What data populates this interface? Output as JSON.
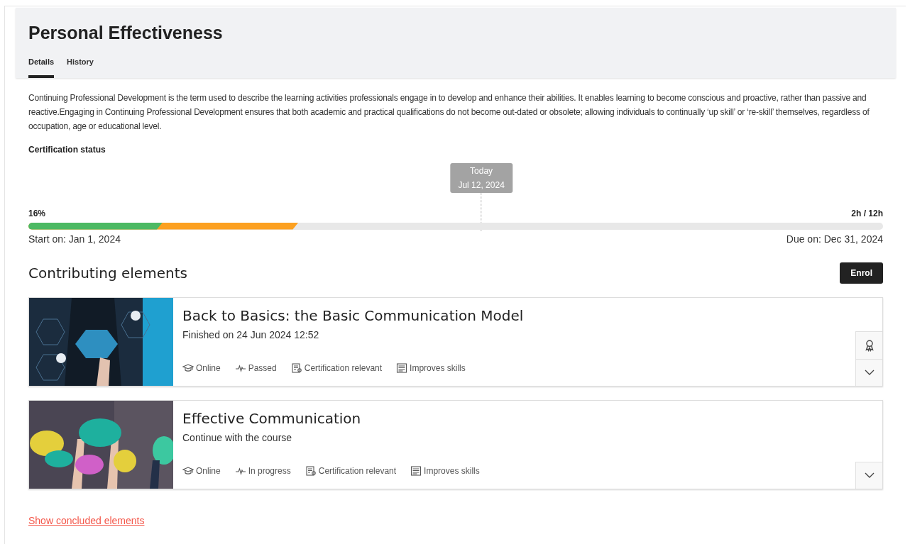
{
  "header": {
    "title": "Personal Effectiveness",
    "tabs": [
      {
        "label": "Details",
        "selected": true
      },
      {
        "label": "History",
        "selected": false
      }
    ]
  },
  "description": "Continuing Professional Development is the term used to describe the learning activities professionals engage in to develop and enhance their abilities. It enables learning to become conscious and proactive, rather than passive and reactive.Engaging in Continuing Professional Development ensures that both academic and practical qualifications do not become out-dated or obsolete; allowing individuals to continually ‘up skill’ or ‘re-skill’ themselves, regardless of occupation, age or educational level.",
  "certification": {
    "heading": "Certification status",
    "percent": "16%",
    "hours": "2h / 12h",
    "completed": {
      "level": 0.157
    },
    "in_progress": {
      "level": 0.316
    },
    "today": {
      "label": "Today",
      "date": "Jul 12, 2024",
      "level": 0.53
    },
    "start": "Start on: Jan 1, 2024",
    "due": "Due on: Dec 31, 2024"
  },
  "contributing": {
    "heading": "Contributing elements",
    "button": "Enrol",
    "items": [
      {
        "title": "Back to Basics: the Basic Communication Model",
        "subtitle": "Finished on 24 Jun 2024 12:52",
        "certificate": true,
        "expanded": false,
        "tags": [
          {
            "kind": "mode",
            "label": "Online"
          },
          {
            "kind": "status",
            "label": "Passed"
          },
          {
            "kind": "certification",
            "label": "Certification relevant"
          },
          {
            "kind": "skills",
            "label": "Improves skills"
          }
        ]
      },
      {
        "title": "Effective Communication",
        "subtitle": "Continue with the course",
        "certificate": false,
        "expanded": false,
        "tags": [
          {
            "kind": "mode",
            "label": "Online"
          },
          {
            "kind": "status",
            "label": "In progress"
          },
          {
            "kind": "certification",
            "label": "Certification relevant"
          },
          {
            "kind": "skills",
            "label": "Improves skills"
          }
        ]
      }
    ]
  },
  "footer_link": "Show concluded elements"
}
